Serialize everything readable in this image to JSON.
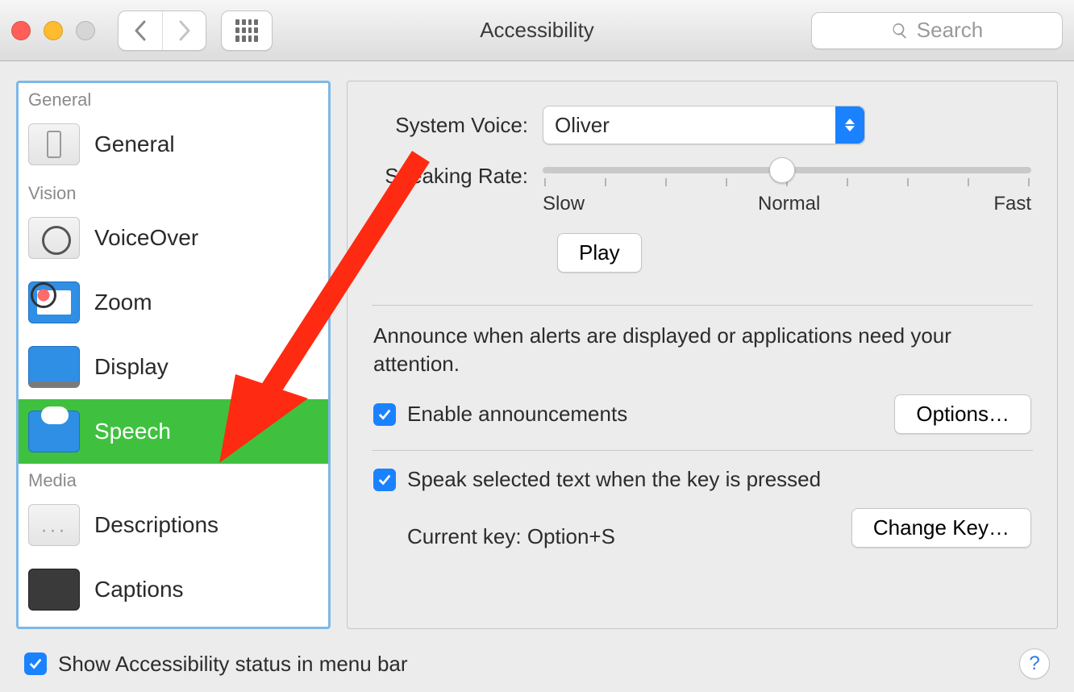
{
  "window": {
    "title": "Accessibility",
    "search_placeholder": "Search"
  },
  "sidebar": {
    "sections": [
      {
        "label": "General",
        "items": [
          {
            "label": "General"
          }
        ]
      },
      {
        "label": "Vision",
        "items": [
          {
            "label": "VoiceOver"
          },
          {
            "label": "Zoom"
          },
          {
            "label": "Display"
          },
          {
            "label": "Speech",
            "selected": true
          }
        ]
      },
      {
        "label": "Media",
        "items": [
          {
            "label": "Descriptions"
          },
          {
            "label": "Captions"
          }
        ]
      }
    ]
  },
  "pane": {
    "system_voice_label": "System Voice:",
    "system_voice_value": "Oliver",
    "speaking_rate_label": "Speaking Rate:",
    "slider": {
      "min_label": "Slow",
      "mid_label": "Normal",
      "max_label": "Fast"
    },
    "play_label": "Play",
    "announce_text": "Announce when alerts are displayed or applications need your attention.",
    "enable_announcements_label": "Enable announcements",
    "options_label": "Options…",
    "speak_selected_label": "Speak selected text when the key is pressed",
    "current_key_label": "Current key: Option+S",
    "change_key_label": "Change Key…"
  },
  "footer": {
    "show_status_label": "Show Accessibility status in menu bar",
    "help_symbol": "?"
  }
}
